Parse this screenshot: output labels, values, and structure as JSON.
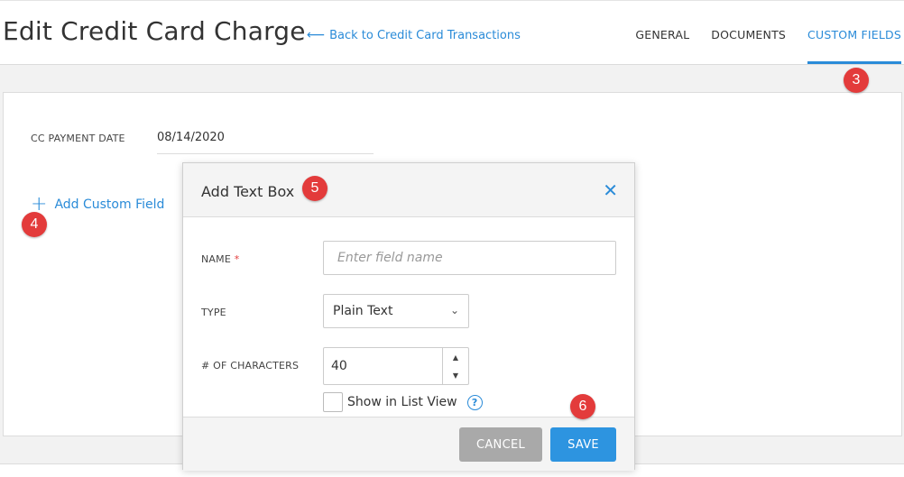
{
  "header": {
    "title": "Edit Credit Card Charge",
    "back_link": "Back to Credit Card Transactions",
    "tabs": [
      {
        "label": "GENERAL",
        "active": false
      },
      {
        "label": "DOCUMENTS",
        "active": false
      },
      {
        "label": "CUSTOM FIELDS",
        "active": true
      }
    ]
  },
  "panel": {
    "payment_date_label": "CC PAYMENT DATE",
    "payment_date_value": "08/14/2020",
    "add_custom_field": "Add Custom Field"
  },
  "modal": {
    "title": "Add Text Box",
    "close_icon": "close-icon",
    "name_label": "NAME",
    "name_required": "*",
    "name_placeholder": "Enter field name",
    "type_label": "TYPE",
    "type_value": "Plain Text",
    "chars_label": "# OF CHARACTERS",
    "chars_value": "40",
    "show_in_list": "Show in List View",
    "cancel": "CANCEL",
    "save": "SAVE"
  },
  "badges": {
    "b3": "3",
    "b4": "4",
    "b5": "5",
    "b6": "6"
  },
  "colors": {
    "accent": "#2a8bd8",
    "badge": "#e33b3b",
    "save_button": "#2d94e0",
    "cancel_button": "#a9a9a9"
  }
}
